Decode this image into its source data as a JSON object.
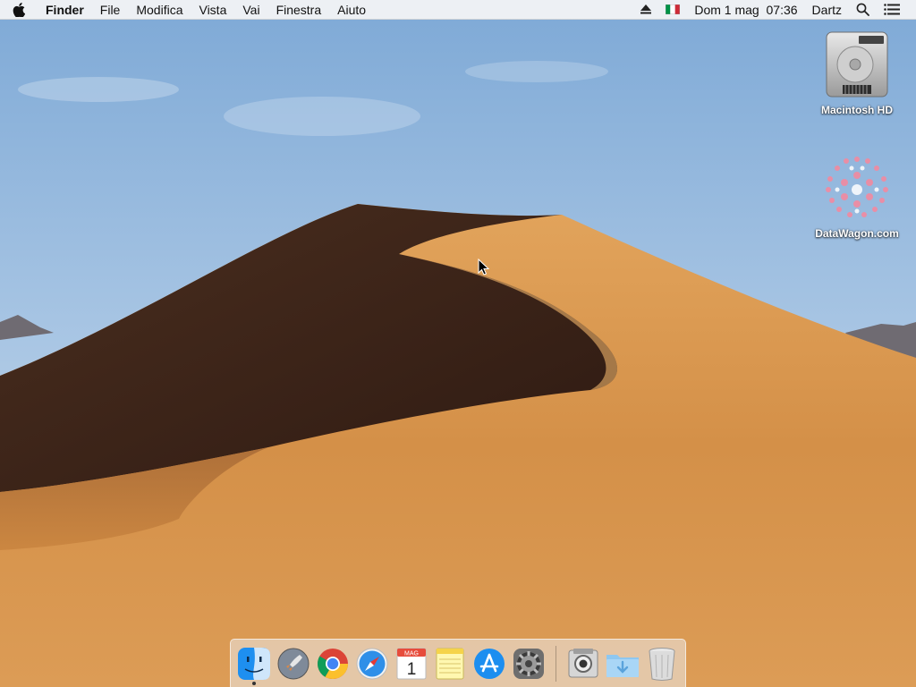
{
  "menubar": {
    "app_name": "Finder",
    "menus": [
      "File",
      "Modifica",
      "Vista",
      "Vai",
      "Finestra",
      "Aiuto"
    ],
    "status": {
      "date": "Dom 1 mag",
      "time": "07:36",
      "user": "Dartz"
    }
  },
  "desktop": {
    "icons": [
      {
        "label": "Macintosh HD",
        "icon": "hard-drive-icon"
      },
      {
        "label": "DataWagon.com",
        "icon": "disk-image-icon"
      }
    ]
  },
  "dock": {
    "apps": [
      {
        "name": "Finder",
        "icon": "finder-icon",
        "running": true
      },
      {
        "name": "Launchpad",
        "icon": "launchpad-icon"
      },
      {
        "name": "Google Chrome",
        "icon": "chrome-icon"
      },
      {
        "name": "Safari",
        "icon": "safari-icon"
      },
      {
        "name": "Calendario",
        "icon": "calendar-icon",
        "month": "MAG",
        "day": "1"
      },
      {
        "name": "Note",
        "icon": "notes-icon"
      },
      {
        "name": "App Store",
        "icon": "app-store-icon"
      },
      {
        "name": "Preferenze di Sistema",
        "icon": "system-preferences-icon"
      },
      {
        "name": "Preview",
        "icon": "preview-icon"
      },
      {
        "name": "Download",
        "icon": "downloads-folder-icon"
      },
      {
        "name": "Cestino",
        "icon": "trash-icon"
      }
    ]
  },
  "colors": {
    "sky_top": "#7aa8d8",
    "sky_bottom": "#cfe0ee",
    "dune_light": "#d99a52",
    "dune_shadow": "#3b2418"
  }
}
